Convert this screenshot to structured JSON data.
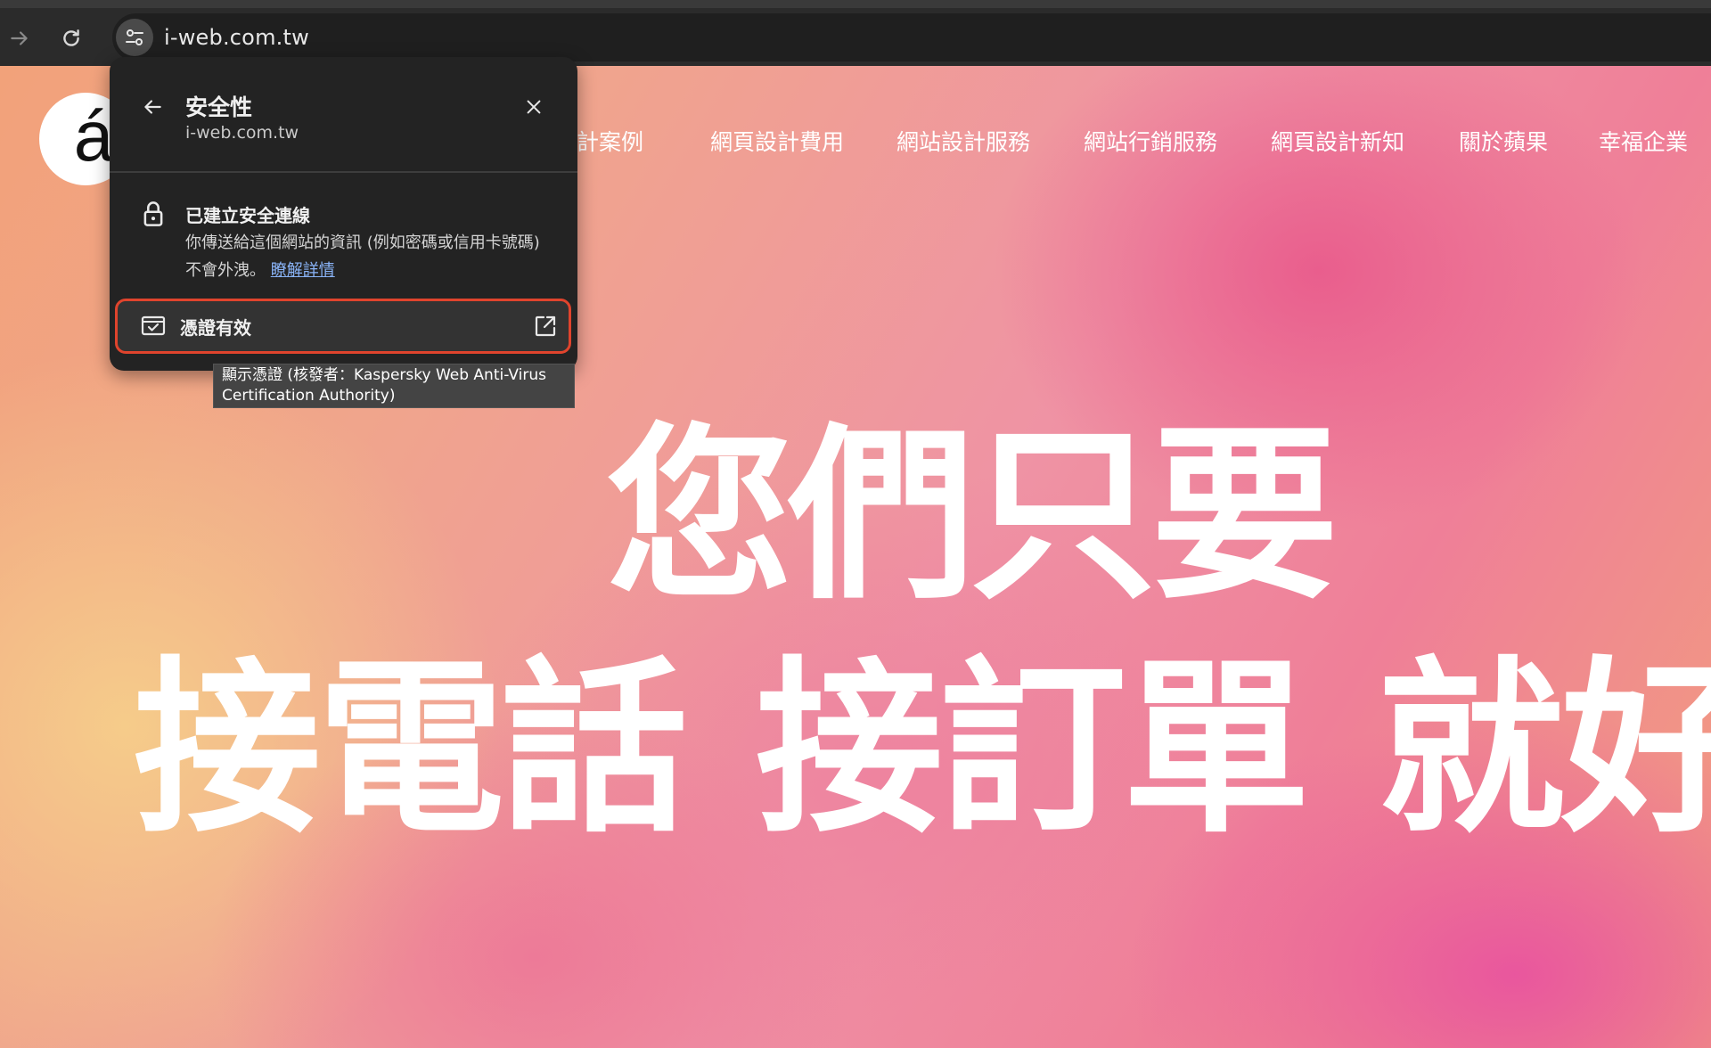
{
  "browser": {
    "url": "i-web.com.tw",
    "forward_icon": "arrow-right-icon",
    "reload_icon": "reload-icon",
    "site_info_icon": "tune-icon"
  },
  "site": {
    "nav": [
      "設計案例",
      "網頁設計費用",
      "網站設計服務",
      "網站行銷服務",
      "網頁設計新知",
      "關於蘋果",
      "幸福企業"
    ],
    "hero_line1": "您們只要",
    "hero_line2": [
      "接電話",
      "接訂單",
      "就好"
    ]
  },
  "security_popup": {
    "title": "安全性",
    "domain": "i-web.com.tw",
    "connection_title": "已建立安全連線",
    "connection_desc": "你傳送給這個網站的資訊 (例如密碼或信用卡號碼) 不會外洩。",
    "learn_more": "瞭解詳情",
    "certificate_label": "憑證有效",
    "tooltip": "顯示憑證 (核發者：Kaspersky Web Anti-Virus Certification Authority)"
  },
  "colors": {
    "highlight_border": "#e0442d",
    "link": "#8ab4f8",
    "popup_bg": "#232323"
  }
}
